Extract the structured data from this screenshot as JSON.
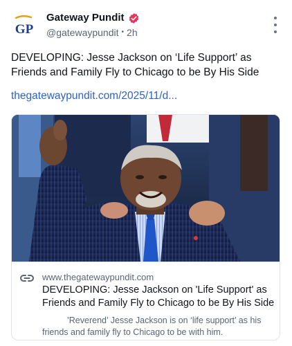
{
  "author": {
    "avatar_text": "GP",
    "name": "Gateway Pundit",
    "handle": "@gatewaypundit",
    "separator": "•",
    "time": "2h"
  },
  "post": {
    "text": "DEVELOPING: Jesse Jackson on ‘Life Support’ as Friends and Family Fly to Chicago to be By His Side",
    "link_text": "thegatewaypundit.com/2025/11/d..."
  },
  "card": {
    "domain": "www.thegatewaypundit.com",
    "title": "DEVELOPING: Jesse Jackson on 'Life Support' as Friends and Family Fly to Chicago to be By His Side",
    "description": "’Reverend’ Jesse Jackson is on ‘life support’ as his friends and family fly to Chicago to be with him."
  },
  "icons": {
    "verified": "verified-badge-icon",
    "more": "more-vertical-icon",
    "link": "link-icon"
  },
  "colors": {
    "link": "#2b63c7",
    "verified": "#e8335d",
    "brand_blue": "#1d3f8f",
    "brand_gold": "#e0a21b",
    "muted": "#5b6470"
  }
}
